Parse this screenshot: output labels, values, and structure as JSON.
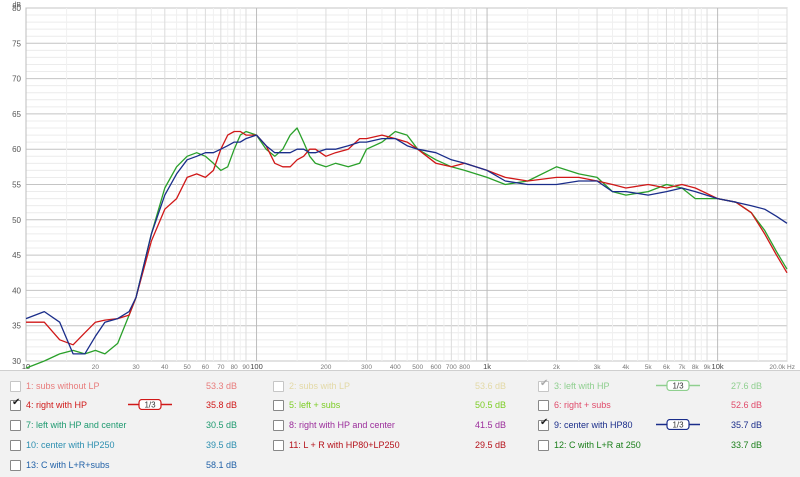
{
  "chart_data": {
    "type": "line",
    "y_unit": "dB",
    "x_scale": "log",
    "xlim": [
      10,
      20000
    ],
    "ylim": [
      30,
      80
    ],
    "y_ticks": [
      30,
      35,
      40,
      45,
      50,
      55,
      60,
      65,
      70,
      75,
      80
    ],
    "x_ticks": [
      "10",
      "20",
      "30",
      "40",
      "50",
      "60",
      "70",
      "80",
      "90",
      "100",
      "200",
      "300",
      "400",
      "500",
      "600",
      "700",
      "800",
      "1k",
      "2k",
      "3k",
      "4k",
      "5k",
      "6k",
      "7k",
      "8k",
      "9k",
      "10k",
      "20.0k Hz"
    ],
    "grid": true,
    "series": [
      {
        "name": "left with HP",
        "color": "#2aa02a",
        "x": [
          10,
          12,
          14,
          16,
          18,
          20,
          22,
          25,
          28,
          30,
          35,
          40,
          45,
          50,
          55,
          60,
          65,
          70,
          75,
          80,
          85,
          90,
          100,
          110,
          120,
          130,
          140,
          150,
          160,
          170,
          180,
          200,
          220,
          250,
          280,
          300,
          350,
          400,
          450,
          500,
          600,
          700,
          800,
          1000,
          1200,
          1500,
          2000,
          2500,
          3000,
          3500,
          4000,
          5000,
          6000,
          7000,
          8000,
          10000,
          12000,
          14000,
          16000,
          18000,
          20000
        ],
        "y": [
          29,
          30,
          31,
          31.5,
          31,
          31.5,
          31,
          32.5,
          36.5,
          39,
          48,
          54.5,
          57.5,
          59,
          59.5,
          59,
          58,
          57,
          57.5,
          60,
          62,
          62.5,
          62,
          60,
          59,
          60,
          62,
          63,
          61,
          59,
          58,
          57.5,
          58,
          57.5,
          58,
          60,
          61,
          62.5,
          62,
          60,
          58.5,
          57.5,
          57,
          56,
          55,
          55.5,
          57.5,
          56.5,
          56,
          54,
          53.5,
          54,
          55,
          54.5,
          53,
          53,
          52.5,
          51,
          48.5,
          45.5,
          43
        ]
      },
      {
        "name": "right with HP",
        "color": "#d01818",
        "x": [
          10,
          12,
          14,
          16,
          18,
          20,
          22,
          25,
          28,
          30,
          35,
          40,
          45,
          50,
          55,
          60,
          65,
          70,
          75,
          80,
          85,
          90,
          100,
          110,
          120,
          130,
          140,
          150,
          160,
          170,
          180,
          200,
          220,
          250,
          280,
          300,
          350,
          400,
          450,
          500,
          600,
          700,
          800,
          1000,
          1200,
          1500,
          2000,
          2500,
          3000,
          3500,
          4000,
          5000,
          6000,
          7000,
          8000,
          10000,
          12000,
          14000,
          16000,
          18000,
          20000
        ],
        "y": [
          35.5,
          35.5,
          33,
          32.3,
          34,
          35.5,
          35.8,
          36,
          36.5,
          39,
          47,
          51.5,
          53,
          56,
          56.5,
          56,
          57,
          60,
          62,
          62.5,
          62.5,
          62,
          62,
          60.5,
          58,
          57.5,
          57.5,
          58.5,
          59,
          60,
          60,
          59,
          59.5,
          60,
          61.5,
          61.5,
          62,
          61.5,
          61,
          60,
          58,
          57.5,
          58,
          57,
          56,
          55.5,
          56,
          56,
          55.5,
          55,
          54.5,
          55,
          54.5,
          55,
          54.5,
          53,
          52.5,
          51,
          48,
          45,
          42.5
        ]
      },
      {
        "name": "center with HP80",
        "color": "#1a2d8a",
        "x": [
          10,
          12,
          14,
          16,
          18,
          20,
          22,
          25,
          28,
          30,
          35,
          40,
          45,
          50,
          55,
          60,
          65,
          70,
          75,
          80,
          85,
          90,
          100,
          110,
          120,
          130,
          140,
          150,
          160,
          170,
          180,
          200,
          220,
          250,
          280,
          300,
          350,
          400,
          450,
          500,
          600,
          700,
          800,
          1000,
          1200,
          1500,
          2000,
          2500,
          3000,
          3500,
          4000,
          5000,
          6000,
          7000,
          8000,
          10000,
          12000,
          14000,
          16000,
          18000,
          20000
        ],
        "y": [
          36,
          37,
          35.5,
          31,
          31,
          33.5,
          35.5,
          36,
          37,
          39,
          48,
          53.5,
          56.5,
          58.5,
          59,
          59.5,
          59.5,
          60,
          60.5,
          61,
          61,
          61.5,
          62,
          60.5,
          59.5,
          59.5,
          59.5,
          60,
          60,
          59.5,
          59.5,
          60,
          60,
          60.5,
          61,
          61,
          61.5,
          61.5,
          60.5,
          60,
          59.5,
          58.5,
          58,
          57,
          55.5,
          55,
          55,
          55.5,
          55.5,
          54,
          54,
          53.5,
          54,
          54.5,
          54,
          53,
          52.5,
          52,
          51.5,
          50.5,
          49.5
        ]
      }
    ]
  },
  "legend": {
    "items": [
      {
        "id": "1",
        "label": "1: subs without LP",
        "value": "53.3 dB",
        "checked": false,
        "dim": true,
        "color": "#e87c7c"
      },
      {
        "id": "2",
        "label": "2: subs with LP",
        "value": "53.6 dB",
        "checked": false,
        "dim": true,
        "color": "#e3d9a6"
      },
      {
        "id": "3",
        "label": "3: left with HP",
        "value": "27.6 dB",
        "checked": true,
        "dim": true,
        "color": "#8fcf8f",
        "smoothing": "1/3"
      },
      {
        "id": "4",
        "label": "4: right with HP",
        "value": "35.8 dB",
        "checked": true,
        "dim": false,
        "color": "#d01818",
        "smoothing": "1/3"
      },
      {
        "id": "5",
        "label": "5: left + subs",
        "value": "50.5 dB",
        "checked": false,
        "dim": false,
        "color": "#7ccd24"
      },
      {
        "id": "6",
        "label": "6: right + subs",
        "value": "52.6 dB",
        "checked": false,
        "dim": false,
        "color": "#e04a6a"
      },
      {
        "id": "7",
        "label": "7: left with HP and center",
        "value": "30.5 dB",
        "checked": false,
        "dim": false,
        "color": "#1e9a70"
      },
      {
        "id": "8",
        "label": "8: right with HP and center",
        "value": "41.5 dB",
        "checked": false,
        "dim": false,
        "color": "#9b2d9b"
      },
      {
        "id": "9",
        "label": "9: center with HP80",
        "value": "35.7 dB",
        "checked": true,
        "dim": false,
        "color": "#1a2d8a",
        "smoothing": "1/3"
      },
      {
        "id": "10",
        "label": "10: center with HP250",
        "value": "39.5 dB",
        "checked": false,
        "dim": false,
        "color": "#2d8fb0"
      },
      {
        "id": "11",
        "label": "11: L + R with HP80+LP250",
        "value": "29.5 dB",
        "checked": false,
        "dim": false,
        "color": "#b5121b"
      },
      {
        "id": "12",
        "label": "12: C with L+R at 250",
        "value": "33.7 dB",
        "checked": false,
        "dim": false,
        "color": "#1a7f1a"
      },
      {
        "id": "13",
        "label": "13: C with L+R+subs",
        "value": "58.1 dB",
        "checked": false,
        "dim": false,
        "color": "#2262a8"
      }
    ]
  }
}
